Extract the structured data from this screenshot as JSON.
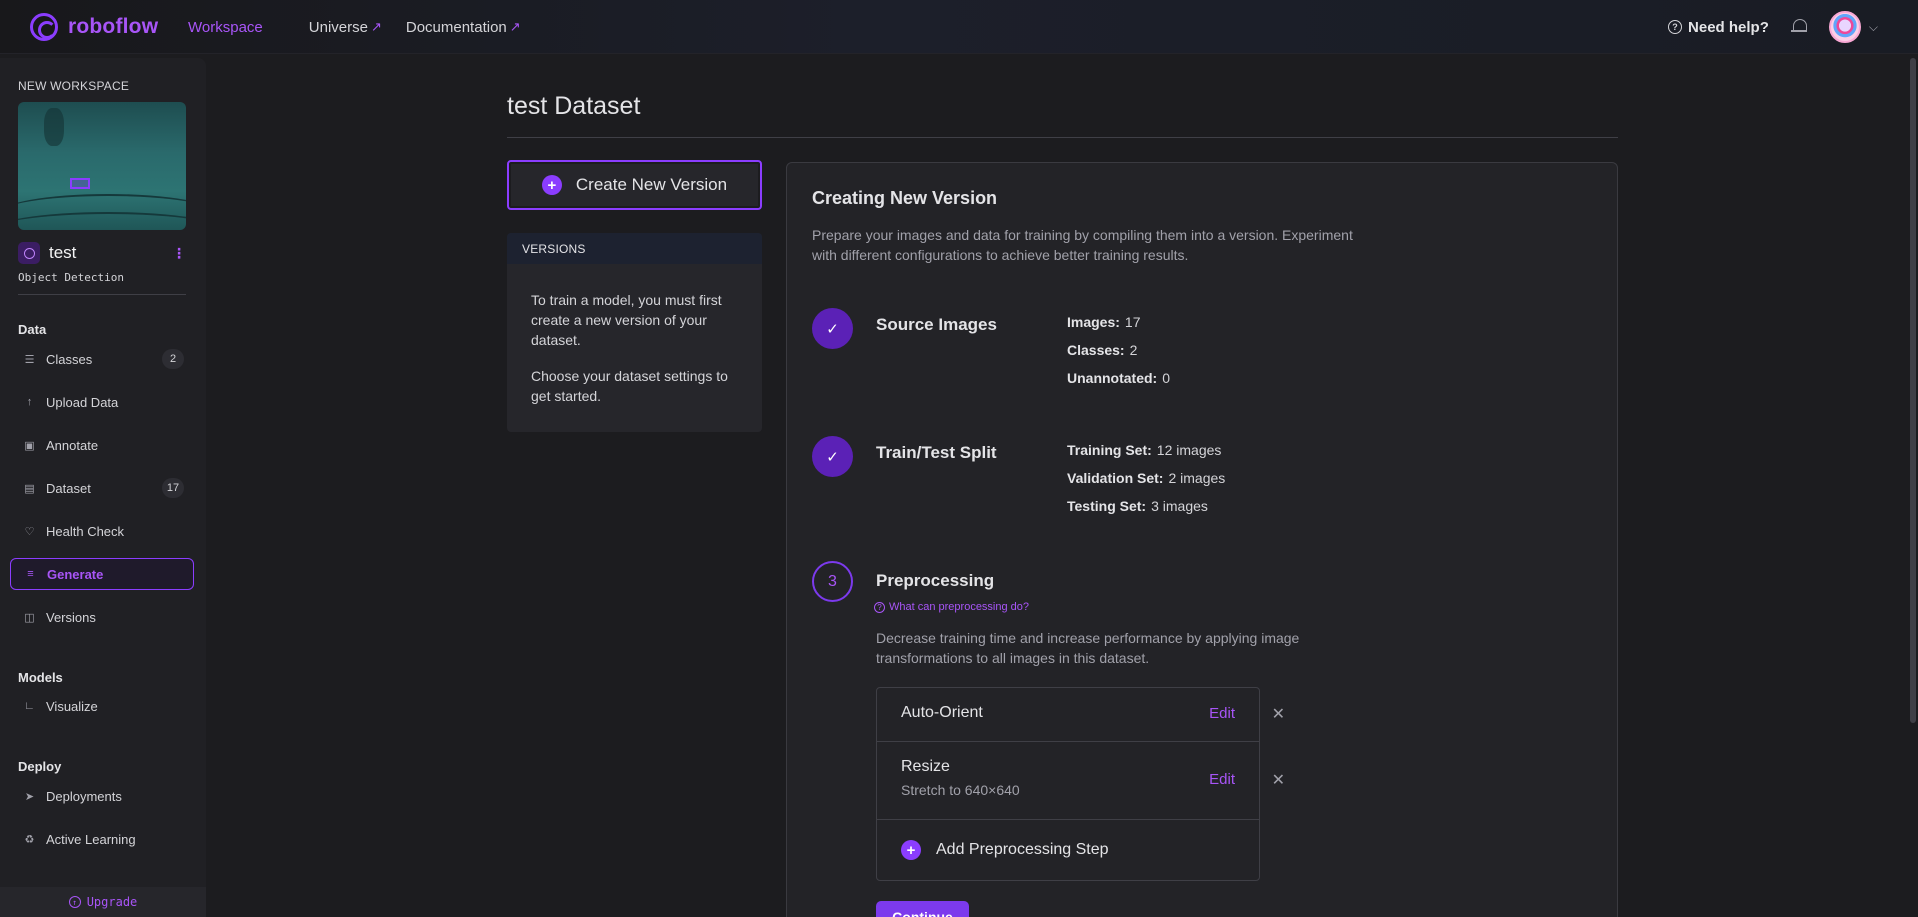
{
  "nav": {
    "logo_text": "roboflow",
    "links": [
      {
        "label": "Workspace",
        "external": false,
        "active": true
      },
      {
        "label": "Universe",
        "external": true,
        "active": false
      },
      {
        "label": "Documentation",
        "external": true,
        "active": false
      }
    ],
    "help_label": "Need help?",
    "external_glyph": "↗"
  },
  "sidebar": {
    "workspace_label": "NEW WORKSPACE",
    "project": {
      "name": "test",
      "type": "Object Detection"
    },
    "sections": {
      "data": "Data",
      "models": "Models",
      "deploy": "Deploy"
    },
    "items": [
      {
        "label": "Classes",
        "icon": "list-icon",
        "count": "2"
      },
      {
        "label": "Upload Data",
        "icon": "upload-icon",
        "count": ""
      },
      {
        "label": "Annotate",
        "icon": "annotate-icon",
        "count": ""
      },
      {
        "label": "Dataset",
        "icon": "images-icon",
        "count": "17"
      },
      {
        "label": "Health Check",
        "icon": "heart-pulse-icon",
        "count": ""
      },
      {
        "label": "Generate",
        "icon": "layers-icon",
        "count": "",
        "active": true
      },
      {
        "label": "Versions",
        "icon": "versions-icon",
        "count": ""
      },
      {
        "label": "Visualize",
        "icon": "chart-icon",
        "count": ""
      },
      {
        "label": "Deployments",
        "icon": "rocket-icon",
        "count": ""
      },
      {
        "label": "Active Learning",
        "icon": "recycle-icon",
        "count": ""
      }
    ],
    "upgrade_label": "Upgrade"
  },
  "main": {
    "title": "test Dataset",
    "create_button": "Create New Version",
    "versions": {
      "header": "VERSIONS",
      "text1": "To train a model, you must first create a new version of your dataset.",
      "text2": "Choose your dataset settings to get started."
    }
  },
  "card": {
    "title": "Creating New Version",
    "desc": "Prepare your images and data for training by compiling them into a version. Experiment with different configurations to achieve better training results.",
    "steps": {
      "source": {
        "name": "Source Images",
        "stats": [
          {
            "k": "Images:",
            "v": "17"
          },
          {
            "k": "Classes:",
            "v": "2"
          },
          {
            "k": "Unannotated:",
            "v": "0"
          }
        ]
      },
      "split": {
        "name": "Train/Test Split",
        "stats": [
          {
            "k": "Training Set:",
            "v": "12 images"
          },
          {
            "k": "Validation Set:",
            "v": "2 images"
          },
          {
            "k": "Testing Set:",
            "v": "3 images"
          }
        ]
      },
      "pre": {
        "number": "3",
        "name": "Preprocessing",
        "help": "What can preprocessing do?",
        "desc": "Decrease training time and increase performance by applying image transformations to all images in this dataset.",
        "items": [
          {
            "name": "Auto-Orient",
            "sub": "",
            "edit": "Edit"
          },
          {
            "name": "Resize",
            "sub": "Stretch to 640×640",
            "edit": "Edit"
          }
        ],
        "add_label": "Add Preprocessing Step",
        "continue_label": "Continue"
      }
    }
  },
  "colors": {
    "accent": "#8b3dff",
    "accent_text": "#a855f7",
    "background": "#1c1c1f",
    "panel": "#26262b"
  }
}
